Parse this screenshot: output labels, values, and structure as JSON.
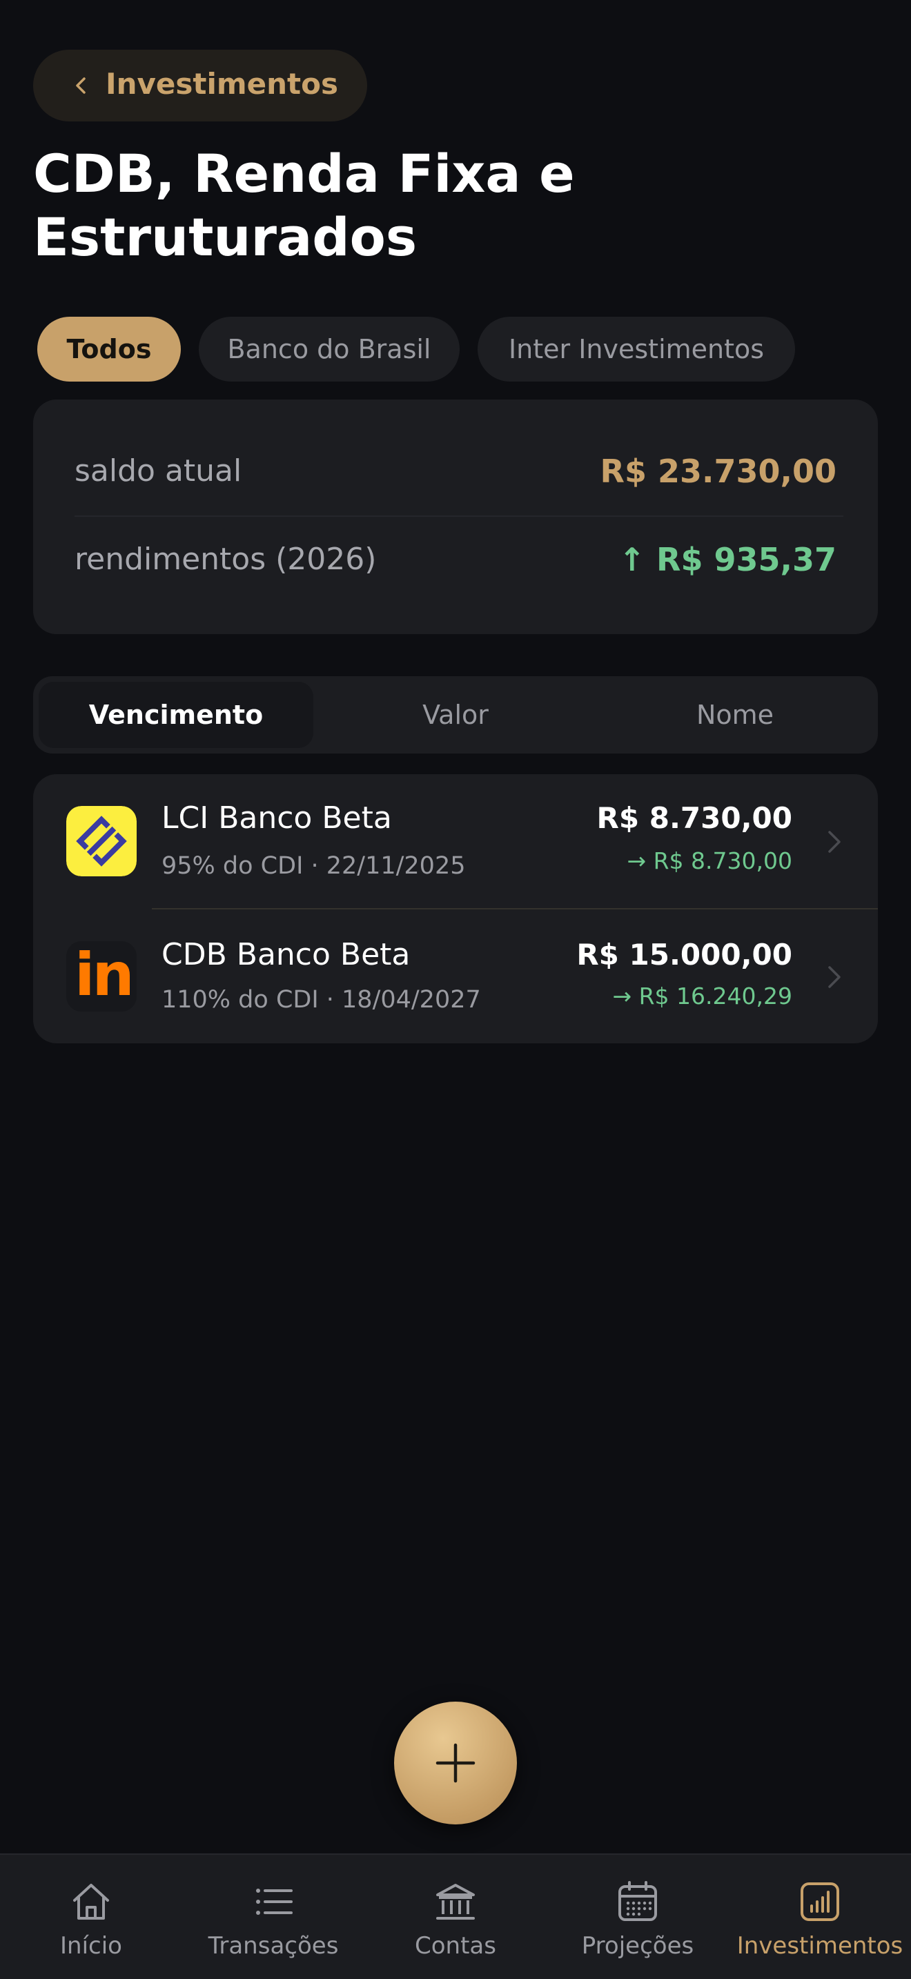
{
  "header": {
    "back_label": "Investimentos",
    "title": "CDB, Renda Fixa e Estruturados"
  },
  "filters": {
    "chips": [
      "Todos",
      "Banco do Brasil",
      "Inter Investimentos"
    ],
    "selected": "Todos"
  },
  "summary": {
    "balance_label": "saldo atual",
    "balance_value": "R$ 23.730,00",
    "yield_label": "rendimentos (2026)",
    "yield_value": "↑ R$ 935,37"
  },
  "sort": {
    "options": [
      "Vencimento",
      "Valor",
      "Nome"
    ],
    "selected": "Vencimento"
  },
  "investments": [
    {
      "name": "LCI Banco Beta",
      "details": "95% do CDI · 22/11/2025",
      "value": "R$ 8.730,00",
      "projected": "→ R$ 8.730,00",
      "logo": "banco-do-brasil-logo"
    },
    {
      "name": "CDB Banco Beta",
      "details": "110% do CDI · 18/04/2027",
      "value": "R$ 15.000,00",
      "projected": "→ R$ 16.240,29",
      "logo": "inter-logo",
      "logo_text": "in"
    }
  ],
  "fab": {
    "icon": "plus-icon"
  },
  "tabbar": {
    "items": [
      {
        "label": "Início",
        "icon": "home-icon"
      },
      {
        "label": "Transações",
        "icon": "list-icon"
      },
      {
        "label": "Contas",
        "icon": "bank-icon"
      },
      {
        "label": "Projeções",
        "icon": "calendar-icon"
      },
      {
        "label": "Investimentos",
        "icon": "chart-icon"
      }
    ],
    "active": "Investimentos"
  },
  "colors": {
    "background": "#0d0e12",
    "card": "#1c1d21",
    "accent_gold": "#c8a16a",
    "positive_green": "#6fc98f",
    "bb_yellow": "#fcee3f",
    "inter_orange": "#ff7a00"
  }
}
